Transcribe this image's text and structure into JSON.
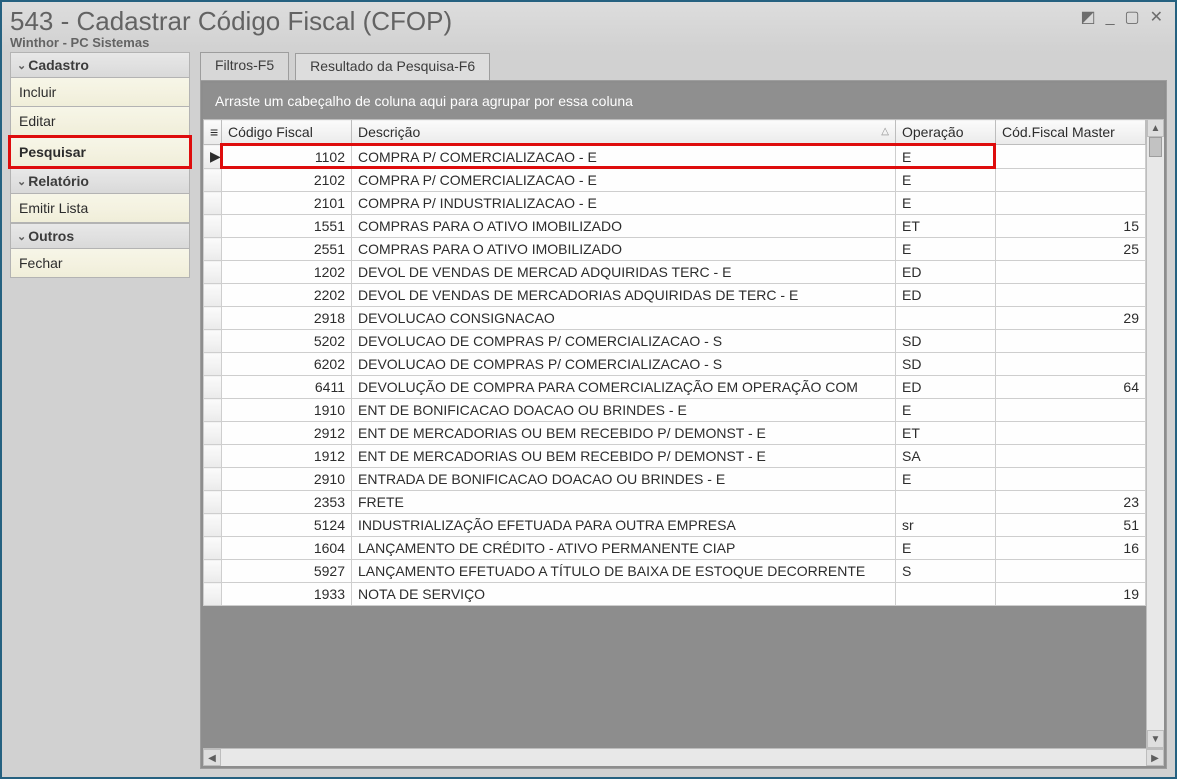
{
  "window": {
    "title": "543 - Cadastrar Código Fiscal (CFOP)",
    "subtitle": "Winthor - PC Sistemas"
  },
  "sidebar": {
    "groups": [
      {
        "label": "Cadastro",
        "items": [
          {
            "label": "Incluir",
            "key": "incluir"
          },
          {
            "label": "Editar",
            "key": "editar"
          },
          {
            "label": "Pesquisar",
            "key": "pesquisar",
            "highlighted": true
          }
        ]
      },
      {
        "label": "Relatório",
        "items": [
          {
            "label": "Emitir Lista",
            "key": "emitir-lista"
          }
        ]
      },
      {
        "label": "Outros",
        "items": [
          {
            "label": "Fechar",
            "key": "fechar"
          }
        ]
      }
    ]
  },
  "tabs": [
    {
      "label": "Filtros-F5",
      "active": false
    },
    {
      "label": "Resultado da Pesquisa-F6",
      "active": true
    }
  ],
  "grid": {
    "group_hint": "Arraste um cabeçalho de coluna aqui para agrupar por essa coluna",
    "columns": [
      {
        "label": "Código Fiscal",
        "key": "codigo"
      },
      {
        "label": "Descrição",
        "key": "desc",
        "sorted": "asc"
      },
      {
        "label": "Operação",
        "key": "oper"
      },
      {
        "label": "Cód.Fiscal Master",
        "key": "master"
      }
    ],
    "rows": [
      {
        "codigo": "1102",
        "desc": "COMPRA P/ COMERCIALIZACAO - E",
        "oper": "E",
        "master": "",
        "current": true,
        "highlighted": true
      },
      {
        "codigo": "2102",
        "desc": "COMPRA P/ COMERCIALIZACAO - E",
        "oper": "E",
        "master": ""
      },
      {
        "codigo": "2101",
        "desc": "COMPRA P/ INDUSTRIALIZACAO - E",
        "oper": "E",
        "master": ""
      },
      {
        "codigo": "1551",
        "desc": "COMPRAS PARA O ATIVO IMOBILIZADO",
        "oper": "ET",
        "master": "15"
      },
      {
        "codigo": "2551",
        "desc": "COMPRAS PARA O ATIVO IMOBILIZADO",
        "oper": "E",
        "master": "25"
      },
      {
        "codigo": "1202",
        "desc": "DEVOL DE VENDAS DE MERCAD ADQUIRIDAS TERC - E",
        "oper": "ED",
        "master": ""
      },
      {
        "codigo": "2202",
        "desc": "DEVOL DE VENDAS DE MERCADORIAS ADQUIRIDAS DE TERC - E",
        "oper": "ED",
        "master": ""
      },
      {
        "codigo": "2918",
        "desc": "DEVOLUCAO CONSIGNACAO",
        "oper": "",
        "master": "29"
      },
      {
        "codigo": "5202",
        "desc": "DEVOLUCAO DE COMPRAS P/ COMERCIALIZACAO - S",
        "oper": "SD",
        "master": ""
      },
      {
        "codigo": "6202",
        "desc": "DEVOLUCAO DE COMPRAS P/ COMERCIALIZACAO - S",
        "oper": "SD",
        "master": ""
      },
      {
        "codigo": "6411",
        "desc": "DEVOLUÇÃO DE COMPRA PARA COMERCIALIZAÇÃO EM OPERAÇÃO COM",
        "oper": "ED",
        "master": "64"
      },
      {
        "codigo": "1910",
        "desc": "ENT DE BONIFICACAO DOACAO OU BRINDES - E",
        "oper": "E",
        "master": ""
      },
      {
        "codigo": "2912",
        "desc": "ENT DE MERCADORIAS OU BEM RECEBIDO P/ DEMONST -  E",
        "oper": "ET",
        "master": ""
      },
      {
        "codigo": "1912",
        "desc": "ENT DE MERCADORIAS OU BEM RECEBIDO P/ DEMONST - E",
        "oper": "SA",
        "master": ""
      },
      {
        "codigo": "2910",
        "desc": "ENTRADA DE BONIFICACAO DOACAO OU BRINDES - E",
        "oper": "E",
        "master": ""
      },
      {
        "codigo": "2353",
        "desc": "FRETE",
        "oper": "",
        "master": "23"
      },
      {
        "codigo": "5124",
        "desc": "INDUSTRIALIZAÇÃO EFETUADA PARA OUTRA EMPRESA",
        "oper": "sr",
        "master": "51"
      },
      {
        "codigo": "1604",
        "desc": "LANÇAMENTO DE CRÉDITO - ATIVO PERMANENTE CIAP",
        "oper": "E",
        "master": "16"
      },
      {
        "codigo": "5927",
        "desc": "LANÇAMENTO EFETUADO A TÍTULO DE BAIXA DE ESTOQUE DECORRENTE",
        "oper": "S",
        "master": ""
      },
      {
        "codigo": "1933",
        "desc": "NOTA DE SERVIÇO",
        "oper": "",
        "master": "19"
      }
    ]
  }
}
